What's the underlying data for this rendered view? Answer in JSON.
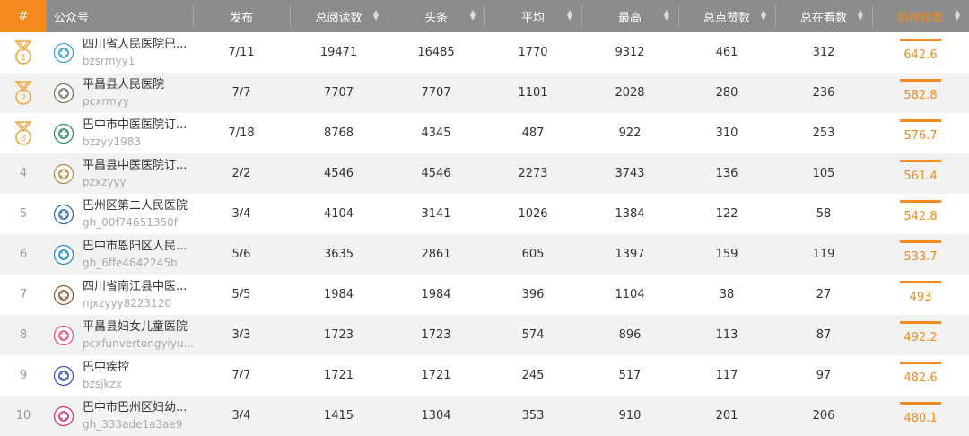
{
  "headers": {
    "rank": "#",
    "account": "公众号",
    "publish": "发布",
    "total_reads": "总阅读数",
    "headline": "头条",
    "average": "平均",
    "max": "最高",
    "total_likes": "总点赞数",
    "total_watching": "总在看数",
    "wci": "新榜指数"
  },
  "colors": {
    "accent": "#f28a1d",
    "header_bg": "#8c8c8c"
  },
  "rows": [
    {
      "rank": "1",
      "name": "四川省人民医院巴...",
      "id": "bzsrmyy1",
      "publish": "7/11",
      "reads": "19471",
      "headline": "16485",
      "avg": "1770",
      "max": "9312",
      "likes": "461",
      "watching": "312",
      "wci": "642.6",
      "medal": "1",
      "icon": "hospital-logo-icon",
      "avatar_color": "#3aa0c9"
    },
    {
      "rank": "2",
      "name": "平昌县人民医院",
      "id": "pcxrmyy",
      "publish": "7/7",
      "reads": "7707",
      "headline": "7707",
      "avg": "1101",
      "max": "2028",
      "likes": "280",
      "watching": "236",
      "wci": "582.8",
      "medal": "2",
      "icon": "building-photo-icon",
      "avatar_color": "#6b7a5a"
    },
    {
      "rank": "3",
      "name": "巴中市中医医院订...",
      "id": "bzzyy1983",
      "publish": "7/18",
      "reads": "8768",
      "headline": "4345",
      "avg": "487",
      "max": "922",
      "likes": "310",
      "watching": "253",
      "wci": "576.7",
      "medal": "3",
      "icon": "hospital-logo-icon",
      "avatar_color": "#2e8b57"
    },
    {
      "rank": "4",
      "name": "平昌县中医医院订...",
      "id": "pzxzyyy",
      "publish": "2/2",
      "reads": "4546",
      "headline": "4546",
      "avg": "2273",
      "max": "3743",
      "likes": "136",
      "watching": "105",
      "wci": "561.4",
      "medal": "",
      "icon": "hospital-logo-icon",
      "avatar_color": "#b08a3e"
    },
    {
      "rank": "5",
      "name": "巴州区第二人民医院",
      "id": "gh_00f74651350f",
      "publish": "3/4",
      "reads": "4104",
      "headline": "3141",
      "avg": "1026",
      "max": "1384",
      "likes": "122",
      "watching": "58",
      "wci": "542.8",
      "medal": "",
      "icon": "hospital-logo-icon",
      "avatar_color": "#2b6cb0"
    },
    {
      "rank": "6",
      "name": "巴中市恩阳区人民...",
      "id": "gh_6ffe4642245b",
      "publish": "5/6",
      "reads": "3635",
      "headline": "2861",
      "avg": "605",
      "max": "1397",
      "likes": "159",
      "watching": "119",
      "wci": "533.7",
      "medal": "",
      "icon": "cross-logo-icon",
      "avatar_color": "#1e88c8"
    },
    {
      "rank": "7",
      "name": "四川省南江县中医...",
      "id": "njxzyyy8223120",
      "publish": "5/5",
      "reads": "1984",
      "headline": "1984",
      "avg": "396",
      "max": "1104",
      "likes": "38",
      "watching": "27",
      "wci": "493",
      "medal": "",
      "icon": "hospital-logo-icon",
      "avatar_color": "#8b5a2b"
    },
    {
      "rank": "8",
      "name": "平昌县妇女儿童医院",
      "id": "pcxfunvertongyiyu...",
      "publish": "3/3",
      "reads": "1723",
      "headline": "1723",
      "avg": "574",
      "max": "896",
      "likes": "113",
      "watching": "87",
      "wci": "492.2",
      "medal": "",
      "icon": "hospital-logo-icon",
      "avatar_color": "#e0507a"
    },
    {
      "rank": "9",
      "name": "巴中疾控",
      "id": "bzsjkzx",
      "publish": "7/7",
      "reads": "1721",
      "headline": "1721",
      "avg": "245",
      "max": "517",
      "likes": "117",
      "watching": "97",
      "wci": "482.6",
      "medal": "",
      "icon": "cdc-logo-icon",
      "avatar_color": "#3355aa"
    },
    {
      "rank": "10",
      "name": "巴中市巴州区妇幼...",
      "id": "gh_333ade1a3ae9",
      "publish": "3/4",
      "reads": "1415",
      "headline": "1304",
      "avg": "353",
      "max": "910",
      "likes": "201",
      "watching": "206",
      "wci": "480.1",
      "medal": "",
      "icon": "heart-logo-icon",
      "avatar_color": "#d6307a"
    }
  ]
}
